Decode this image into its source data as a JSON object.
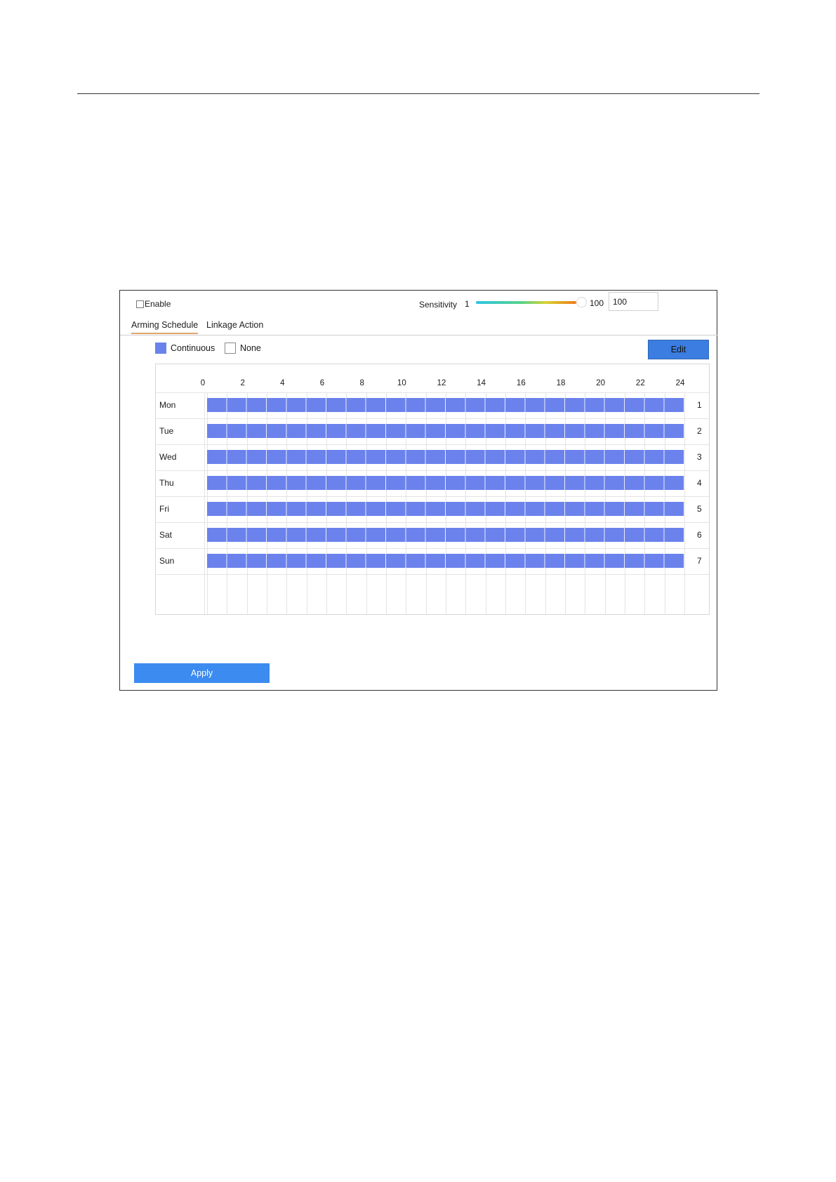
{
  "enable": {
    "label": "Enable",
    "checked": false
  },
  "sensitivity": {
    "label": "Sensitivity",
    "min": "1",
    "max": "100",
    "value": "100"
  },
  "tabs": [
    {
      "label": "Arming Schedule",
      "active": true
    },
    {
      "label": "Linkage Action",
      "active": false
    }
  ],
  "legend": {
    "continuous": {
      "label": "Continuous",
      "color": "#6b82ec"
    },
    "none": {
      "label": "None"
    }
  },
  "edit_label": "Edit",
  "hours": [
    "0",
    "2",
    "4",
    "6",
    "8",
    "10",
    "12",
    "14",
    "16",
    "18",
    "20",
    "22",
    "24"
  ],
  "days": [
    {
      "name": "Mon",
      "num": "1"
    },
    {
      "name": "Tue",
      "num": "2"
    },
    {
      "name": "Wed",
      "num": "3"
    },
    {
      "name": "Thu",
      "num": "4"
    },
    {
      "name": "Fri",
      "num": "5"
    },
    {
      "name": "Sat",
      "num": "6"
    },
    {
      "name": "Sun",
      "num": "7"
    }
  ],
  "apply_label": "Apply",
  "colors": {
    "accent": "#3b7de0",
    "schedule": "#6b82ec",
    "apply": "#3b8bf0"
  }
}
